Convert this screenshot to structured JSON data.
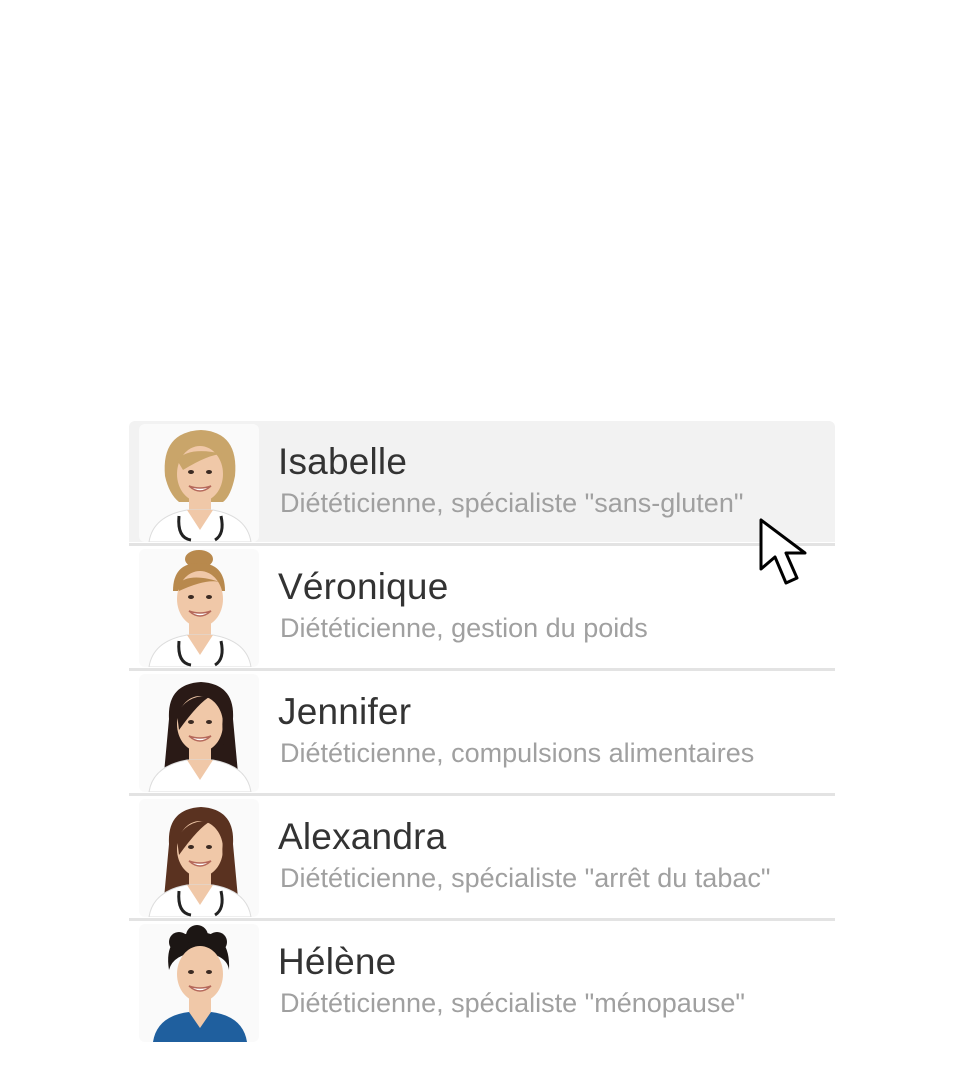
{
  "contacts": [
    {
      "name": "Isabelle",
      "description": "Diététicienne, spécialiste \"sans-gluten\"",
      "selected": true,
      "hair_color": "#c9a56a",
      "hair_style": "short-bob",
      "outfit": "white-coat-stethoscope"
    },
    {
      "name": "Véronique",
      "description": "Diététicienne, gestion du poids",
      "selected": false,
      "hair_color": "#b8894d",
      "hair_style": "bun",
      "outfit": "white-coat-stethoscope"
    },
    {
      "name": "Jennifer",
      "description": "Diététicienne, compulsions alimentaires",
      "selected": false,
      "hair_color": "#2a1a16",
      "hair_style": "long",
      "outfit": "white-coat"
    },
    {
      "name": "Alexandra",
      "description": "Diététicienne, spécialiste \"arrêt du tabac\"",
      "selected": false,
      "hair_color": "#5a3220",
      "hair_style": "long",
      "outfit": "white-coat-stethoscope"
    },
    {
      "name": "Hélène",
      "description": "Diététicienne, spécialiste \"ménopause\"",
      "selected": false,
      "hair_color": "#1c1614",
      "hair_style": "short-curly",
      "outfit": "blue-scrubs"
    }
  ],
  "colors": {
    "selected_row": "#f2f2f2",
    "name_text": "#333333",
    "description_text": "#a0a0a0",
    "separator": "#e3e3e3",
    "skin": "#f0c8a8",
    "coat": "#ffffff",
    "scrubs": "#1f5f9e"
  },
  "cursor": {
    "icon": "arrow-cursor-icon"
  }
}
